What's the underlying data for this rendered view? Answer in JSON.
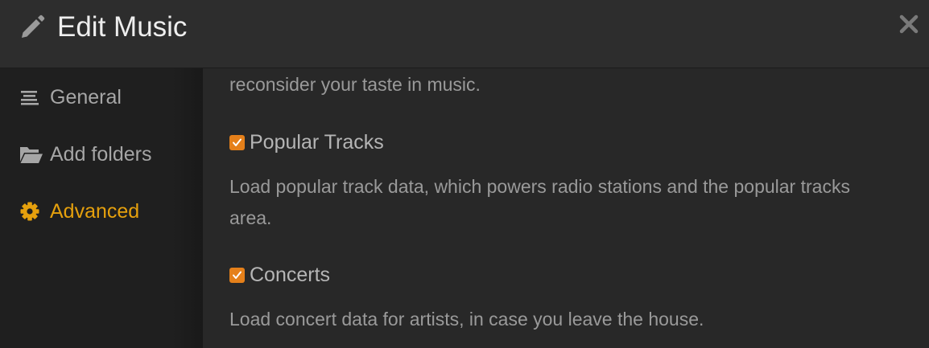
{
  "header": {
    "title": "Edit Music",
    "icon": "pencil-icon",
    "close_icon": "close-icon"
  },
  "sidebar": {
    "items": [
      {
        "label": "General",
        "icon": "align-lines-icon",
        "active": false
      },
      {
        "label": "Add folders",
        "icon": "folder-open-icon",
        "active": false
      },
      {
        "label": "Advanced",
        "icon": "gear-icon",
        "active": true
      }
    ]
  },
  "content": {
    "partial_text": "reconsider your taste in music.",
    "options": [
      {
        "label": "Popular Tracks",
        "checked": true,
        "description": "Load popular track data, which powers radio stations and the popular tracks area."
      },
      {
        "label": "Concerts",
        "checked": true,
        "description": "Load concert data for artists, in case you leave the house."
      }
    ]
  },
  "colors": {
    "accent": "#e5a00d",
    "checkbox": "#e5801a",
    "background": "#282828",
    "sidebar": "#1f1f1f",
    "header": "#2d2d2d"
  }
}
